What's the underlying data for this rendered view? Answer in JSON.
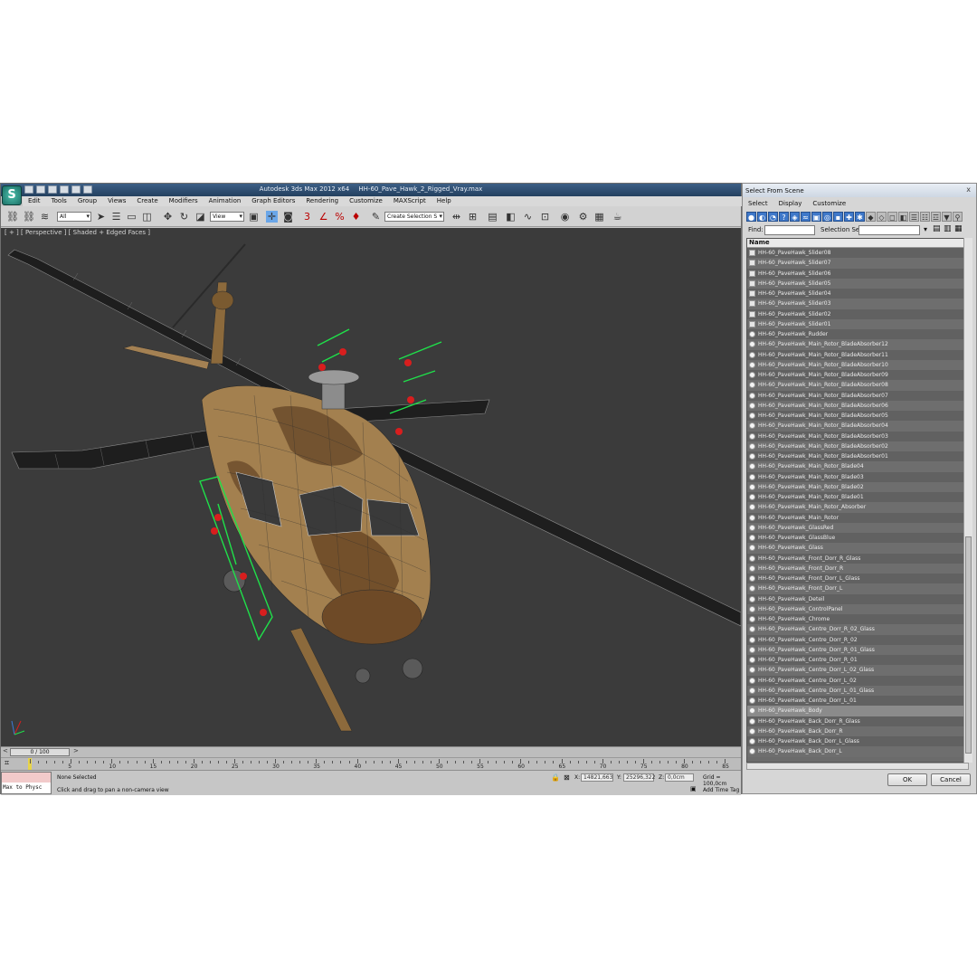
{
  "window": {
    "app_title": "Autodesk 3ds Max  2012 x64",
    "file_name": "HH-60_Pave_Hawk_2_Rigged_Vray.max"
  },
  "menubar": [
    "Edit",
    "Tools",
    "Group",
    "Views",
    "Create",
    "Modifiers",
    "Animation",
    "Graph Editors",
    "Rendering",
    "Customize",
    "MAXScript",
    "Help"
  ],
  "toolbar": {
    "selection_filter": "All",
    "reference_coord": "View",
    "named_selection": "Create Selection S"
  },
  "viewport": {
    "label": "[ + ] [ Perspective ] [ Shaded + Edged Faces ]"
  },
  "timeline": {
    "frame": "0 / 100",
    "ticks": [
      "5",
      "10",
      "15",
      "20",
      "25",
      "30",
      "35",
      "40",
      "45",
      "50",
      "55",
      "60",
      "65",
      "70",
      "75",
      "80",
      "85"
    ]
  },
  "status": {
    "maxscript": "Max to Physc",
    "selection": "None Selected",
    "prompt": "Click and drag to pan a non-camera view",
    "x_label": "X:",
    "x_value": "14821,663",
    "y_label": "Y:",
    "y_value": "25296,322",
    "z_label": "Z:",
    "z_value": "0,0cm",
    "grid": "Grid = 100,0cm",
    "add_time_tag": "Add Time Tag"
  },
  "dialog": {
    "title": "Select From Scene",
    "close": "x",
    "menus": [
      "Select",
      "Display",
      "Customize"
    ],
    "find_label": "Find:",
    "selection_set_label": "Selection Set:",
    "column_header": "Name",
    "ok": "OK",
    "cancel": "Cancel",
    "items": [
      "HH-60_PaveHawk_Slider08",
      "HH-60_PaveHawk_Slider07",
      "HH-60_PaveHawk_Slider06",
      "HH-60_PaveHawk_Slider05",
      "HH-60_PaveHawk_Slider04",
      "HH-60_PaveHawk_Slider03",
      "HH-60_PaveHawk_Slider02",
      "HH-60_PaveHawk_Slider01",
      "HH-60_PaveHawk_Rudder",
      "HH-60_PaveHawk_Main_Rotor_BladeAbsorber12",
      "HH-60_PaveHawk_Main_Rotor_BladeAbsorber11",
      "HH-60_PaveHawk_Main_Rotor_BladeAbsorber10",
      "HH-60_PaveHawk_Main_Rotor_BladeAbsorber09",
      "HH-60_PaveHawk_Main_Rotor_BladeAbsorber08",
      "HH-60_PaveHawk_Main_Rotor_BladeAbsorber07",
      "HH-60_PaveHawk_Main_Rotor_BladeAbsorber06",
      "HH-60_PaveHawk_Main_Rotor_BladeAbsorber05",
      "HH-60_PaveHawk_Main_Rotor_BladeAbsorber04",
      "HH-60_PaveHawk_Main_Rotor_BladeAbsorber03",
      "HH-60_PaveHawk_Main_Rotor_BladeAbsorber02",
      "HH-60_PaveHawk_Main_Rotor_BladeAbsorber01",
      "HH-60_PaveHawk_Main_Rotor_Blade04",
      "HH-60_PaveHawk_Main_Rotor_Blade03",
      "HH-60_PaveHawk_Main_Rotor_Blade02",
      "HH-60_PaveHawk_Main_Rotor_Blade01",
      "HH-60_PaveHawk_Main_Rotor_Absorber",
      "HH-60_PaveHawk_Main_Rotor",
      "HH-60_PaveHawk_GlassRed",
      "HH-60_PaveHawk_GlassBlue",
      "HH-60_PaveHawk_Glass",
      "HH-60_PaveHawk_Front_Dorr_R_Glass",
      "HH-60_PaveHawk_Front_Dorr_R",
      "HH-60_PaveHawk_Front_Dorr_L_Glass",
      "HH-60_PaveHawk_Front_Dorr_L",
      "HH-60_PaveHawk_Deteil",
      "HH-60_PaveHawk_ControlPanel",
      "HH-60_PaveHawk_Chrome",
      "HH-60_PaveHawk_Centre_Dorr_R_02_Glass",
      "HH-60_PaveHawk_Centre_Dorr_R_02",
      "HH-60_PaveHawk_Centre_Dorr_R_01_Glass",
      "HH-60_PaveHawk_Centre_Dorr_R_01",
      "HH-60_PaveHawk_Centre_Dorr_L_02_Glass",
      "HH-60_PaveHawk_Centre_Dorr_L_02",
      "HH-60_PaveHawk_Centre_Dorr_L_01_Glass",
      "HH-60_PaveHawk_Centre_Dorr_L_01",
      "HH-60_PaveHawk_Body",
      "HH-60_PaveHawk_Back_Dorr_R_Glass",
      "HH-60_PaveHawk_Back_Dorr_R",
      "HH-60_PaveHawk_Back_Dorr_L_Glass",
      "HH-60_PaveHawk_Back_Dorr_L"
    ],
    "selected_item": "HH-60_PaveHawk_Body"
  },
  "colors": {
    "viewport_bg": "#3b3b3b",
    "rig_green": "#1fe04a",
    "rig_red": "#d81e1e",
    "title_blue": "#2c4a6e"
  }
}
